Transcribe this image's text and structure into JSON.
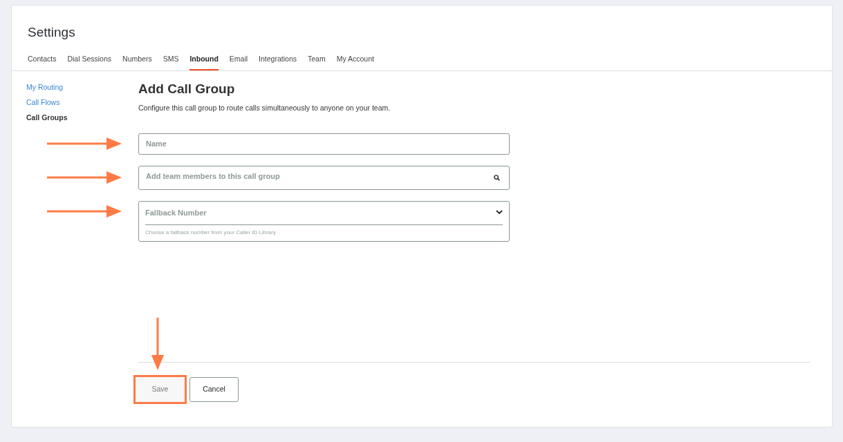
{
  "header": {
    "title": "Settings"
  },
  "tabs": [
    {
      "label": "Contacts",
      "selected": false
    },
    {
      "label": "Dial Sessions",
      "selected": false
    },
    {
      "label": "Numbers",
      "selected": false
    },
    {
      "label": "SMS",
      "selected": false
    },
    {
      "label": "Inbound",
      "selected": true
    },
    {
      "label": "Email",
      "selected": false
    },
    {
      "label": "Integrations",
      "selected": false
    },
    {
      "label": "Team",
      "selected": false
    },
    {
      "label": "My Account",
      "selected": false
    }
  ],
  "sidebar": {
    "items": [
      {
        "label": "My Routing",
        "selected": false
      },
      {
        "label": "Call Flows",
        "selected": false
      },
      {
        "label": "Call Groups",
        "selected": true
      }
    ]
  },
  "form": {
    "title": "Add Call Group",
    "description": "Configure this call group to route calls simultaneously to anyone on your team.",
    "fields": [
      {
        "kind": "text",
        "placeholder": "Name"
      },
      {
        "kind": "search",
        "placeholder": "Add team members to this call group"
      },
      {
        "kind": "select",
        "placeholder": "Fallback Number",
        "hint": "Choose a fallback number from your Caller ID Library"
      }
    ],
    "buttons": [
      {
        "label": "Save",
        "disabled": true,
        "highlighted": true
      },
      {
        "label": "Cancel",
        "disabled": false,
        "highlighted": false
      }
    ]
  }
}
